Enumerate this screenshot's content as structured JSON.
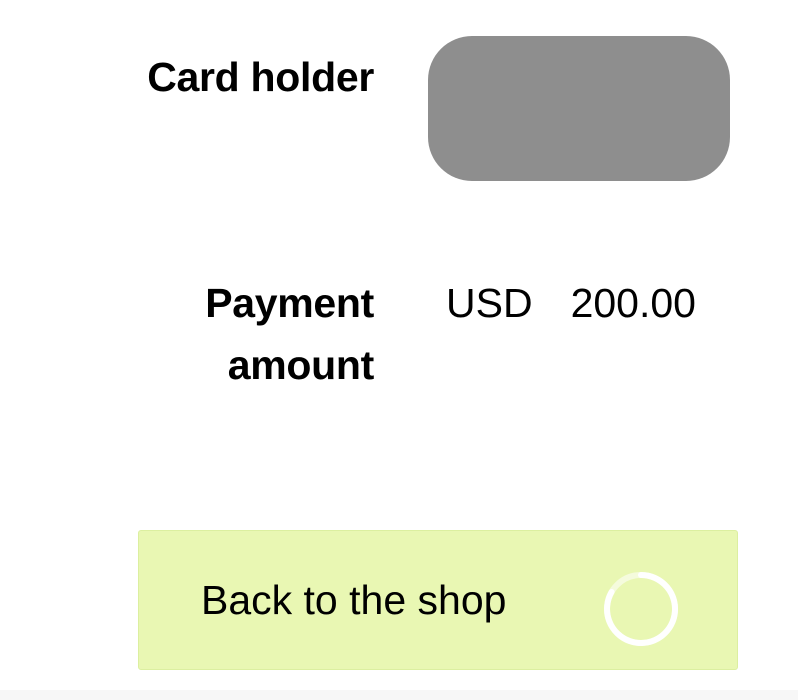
{
  "card_holder": {
    "label": "Card holder",
    "value_field_color": "#8e8e8e"
  },
  "payment_amount": {
    "label_line1": "Payment",
    "label_line2": "amount",
    "currency": "USD",
    "amount": "200.00"
  },
  "back_button": {
    "label": "Back to the shop",
    "background_color": "#e9f7b3",
    "icon": "loading-spinner-icon"
  }
}
